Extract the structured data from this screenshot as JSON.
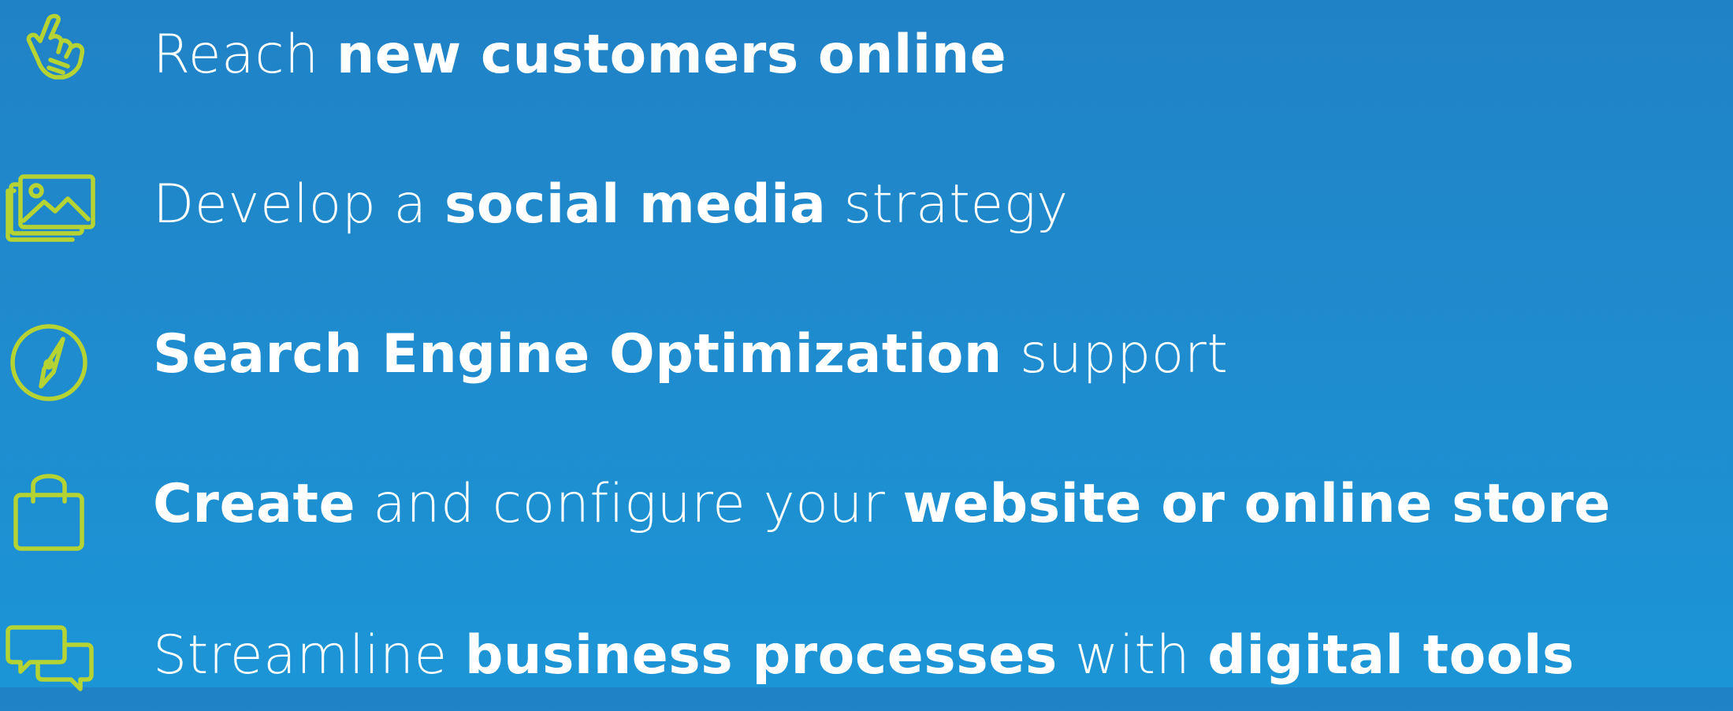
{
  "colors": {
    "background_top": "#2082c6",
    "background_bottom": "#1c95d6",
    "icon": "#b6d334",
    "text": "#ffffff"
  },
  "features": [
    {
      "icon": "pointing-hand-icon",
      "parts": [
        {
          "text": "Reach ",
          "weight": "light"
        },
        {
          "text": "new customers online",
          "weight": "bold"
        }
      ]
    },
    {
      "icon": "image-gallery-icon",
      "parts": [
        {
          "text": "Develop a ",
          "weight": "light"
        },
        {
          "text": "social media",
          "weight": "bold"
        },
        {
          "text": " strategy",
          "weight": "light"
        }
      ]
    },
    {
      "icon": "compass-icon",
      "parts": [
        {
          "text": "Search Engine Optimization",
          "weight": "bold"
        },
        {
          "text": " support",
          "weight": "light"
        }
      ]
    },
    {
      "icon": "shopping-bag-icon",
      "parts": [
        {
          "text": "Create",
          "weight": "bold"
        },
        {
          "text": " and configure your ",
          "weight": "light"
        },
        {
          "text": "website or online store",
          "weight": "bold"
        }
      ]
    },
    {
      "icon": "chat-bubbles-icon",
      "parts": [
        {
          "text": "Streamline ",
          "weight": "light"
        },
        {
          "text": "business processes",
          "weight": "bold"
        },
        {
          "text": " with ",
          "weight": "light"
        },
        {
          "text": "digital tools",
          "weight": "bold"
        }
      ]
    }
  ]
}
